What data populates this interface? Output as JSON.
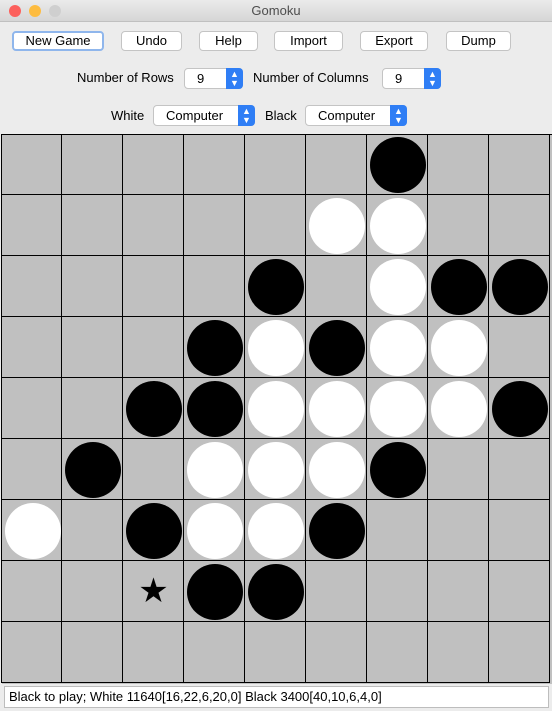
{
  "window": {
    "title": "Gomoku"
  },
  "toolbar": {
    "new_game": "New Game",
    "undo": "Undo",
    "help": "Help",
    "import": "Import",
    "export": "Export",
    "dump": "Dump"
  },
  "settings": {
    "rows_label": "Number of Rows",
    "rows_value": "9",
    "cols_label": "Number of Columns",
    "cols_value": "9",
    "white_label": "White",
    "white_value": "Computer",
    "black_label": "Black",
    "black_value": "Computer"
  },
  "board": {
    "size": 9,
    "rows": [
      "......B..",
      ".....WW..",
      "....B.WBB",
      "...BWBWW.",
      "..BBWWWWB",
      ".B.WWWB..",
      "W.BWWB...",
      "..*BB....",
      "........."
    ],
    "legend": {
      "B": "black-stone",
      "W": "white-stone",
      "*": "last-move-star"
    },
    "star_glyph": "★"
  },
  "status": {
    "text": "Black to play; White 11640[16,22,6,20,0] Black 3400[40,10,6,4,0]"
  }
}
